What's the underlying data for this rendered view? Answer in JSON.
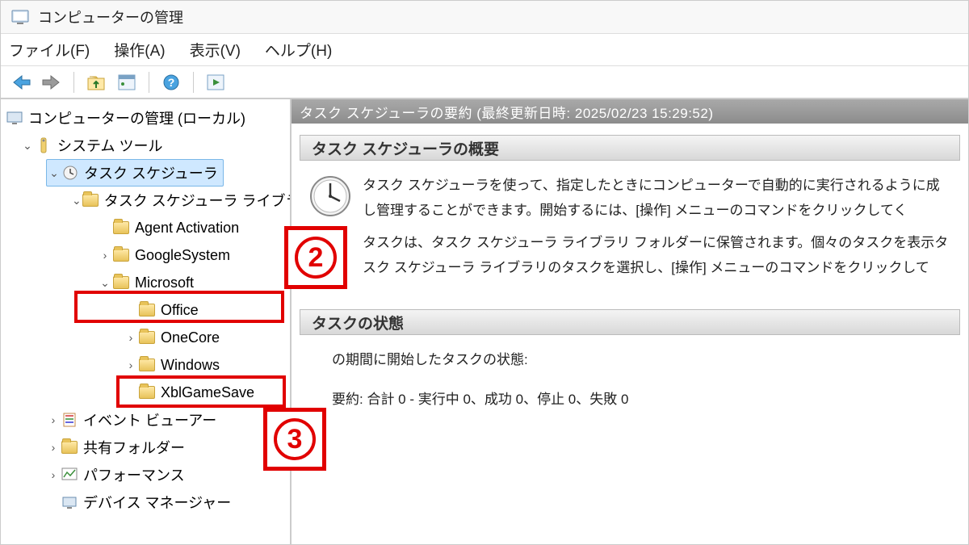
{
  "window": {
    "title": "コンピューターの管理"
  },
  "menu": {
    "file": "ファイル(F)",
    "action": "操作(A)",
    "view": "表示(V)",
    "help": "ヘルプ(H)"
  },
  "tree": {
    "root": "コンピューターの管理 (ローカル)",
    "system_tools": "システム ツール",
    "task_scheduler": "タスク スケジューラ",
    "task_scheduler_library": "タスク スケジューラ ライブラリ",
    "agent_activation": "Agent Activation",
    "google_system": "GoogleSystem",
    "microsoft": "Microsoft",
    "office": "Office",
    "onecore": "OneCore",
    "windows": "Windows",
    "xblgamesave": "XblGameSave",
    "event_viewer": "イベント ビューアー",
    "shared_folders": "共有フォルダー",
    "performance": "パフォーマンス",
    "device_manager": "デバイス マネージャー"
  },
  "content": {
    "summary_header": "タスク スケジューラの要約 (最終更新日時: 2025/02/23 15:29:52)",
    "overview_title": "タスク スケジューラの概要",
    "overview_text1": "タスク スケジューラを使って、指定したときにコンピューターで自動的に実行されるように成し管理することができます。開始するには、[操作] メニューのコマンドをクリックしてく",
    "overview_text2": "タスクは、タスク スケジューラ ライブラリ フォルダーに保管されます。個々のタスクを表示タスク スケジューラ ライブラリのタスクを選択し、[操作] メニューのコマンドをクリックして",
    "status_title": "タスクの状態",
    "status_text1": "の期間に開始したタスクの状態:",
    "status_text2": "要約: 合計 0 - 実行中 0、成功 0、停止 0、失敗 0"
  },
  "annotations": {
    "n2": "2",
    "n3": "3"
  }
}
